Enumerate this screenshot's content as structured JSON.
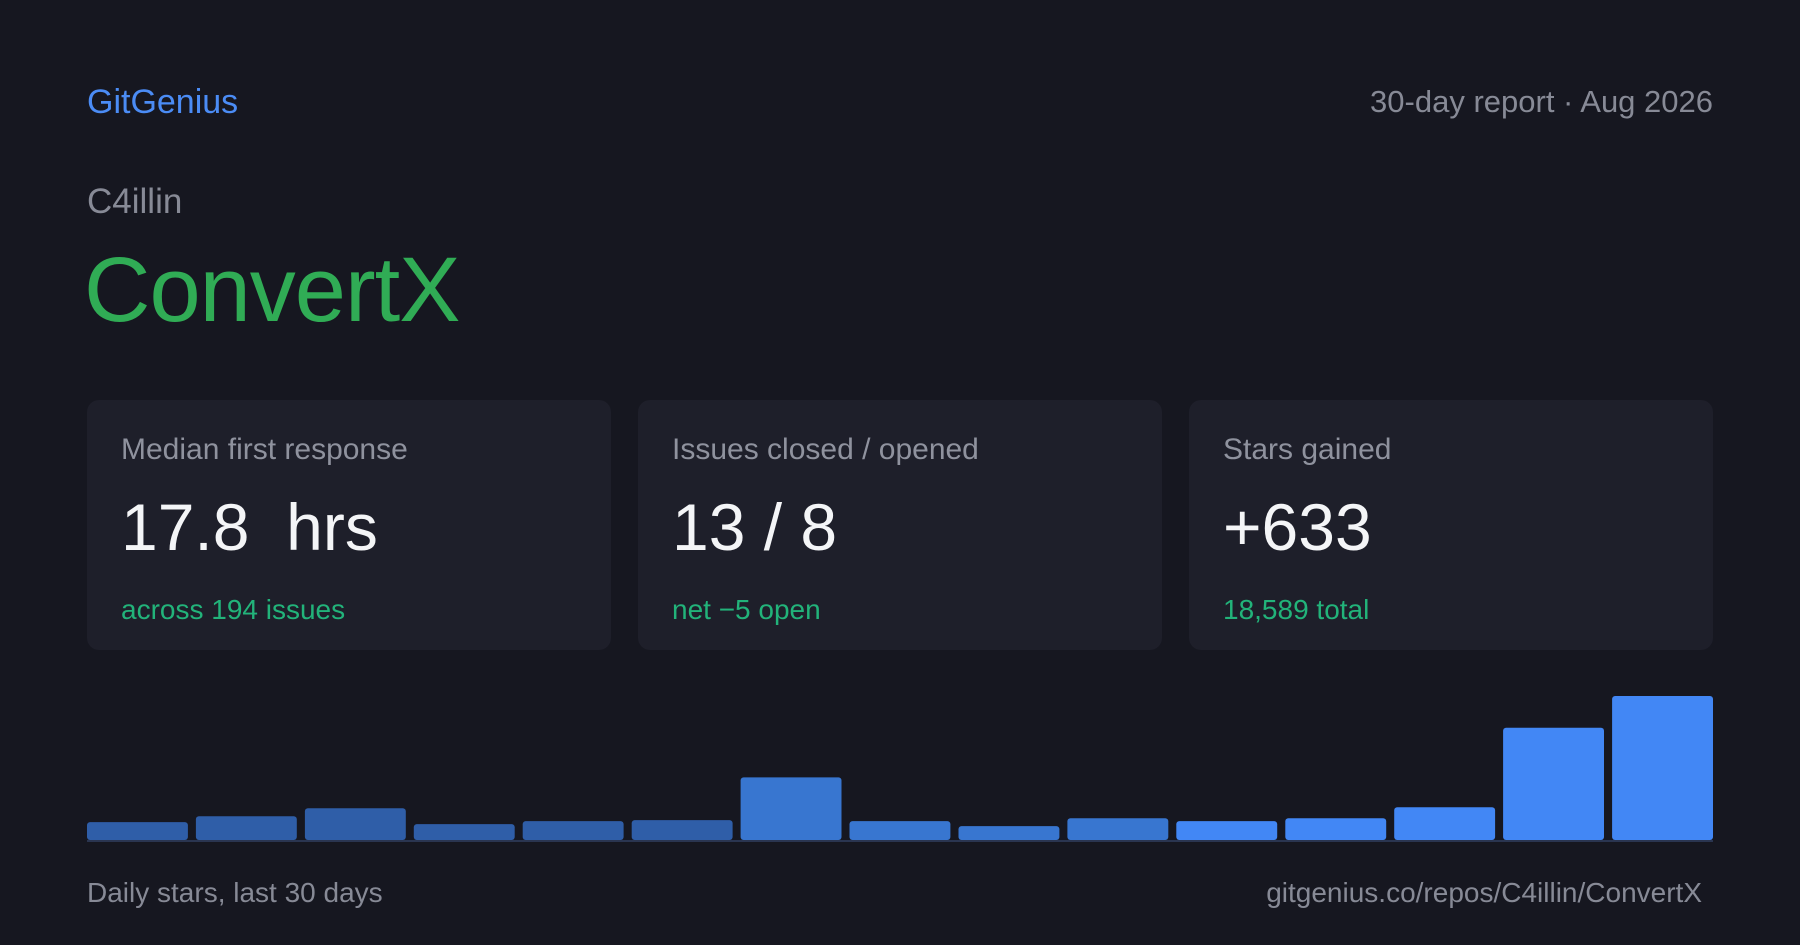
{
  "header": {
    "brand": "GitGenius",
    "report_label": "30-day report · Aug 2026"
  },
  "repo": {
    "owner": "C4illin",
    "name": "ConvertX"
  },
  "cards": [
    {
      "label": "Median first response",
      "value": "17.8  hrs",
      "sub": "across 194 issues"
    },
    {
      "label": "Issues closed / opened",
      "value": "13 / 8",
      "sub": "net −5 open"
    },
    {
      "label": "Stars gained",
      "value": "+633",
      "sub": "18,589 total"
    }
  ],
  "chart_data": {
    "type": "bar",
    "values": [
      18,
      24,
      32,
      16,
      19,
      20,
      63,
      19,
      14,
      22,
      19,
      22,
      33,
      113,
      145
    ],
    "ylim": [
      0,
      145
    ],
    "grid": false,
    "colors": {
      "low": "#2f5ea8",
      "mid": "#3876d0",
      "high": "#4287f5"
    }
  },
  "footer": {
    "caption": "Daily stars, last 30 days",
    "url": "gitgenius.co/repos/C4illin/ConvertX"
  },
  "colors": {
    "background": "#161720",
    "card": "#1e1f2a",
    "brand": "#4b8cf5",
    "repo": "#30ac55",
    "positive": "#22b37a",
    "muted": "#878a96"
  }
}
